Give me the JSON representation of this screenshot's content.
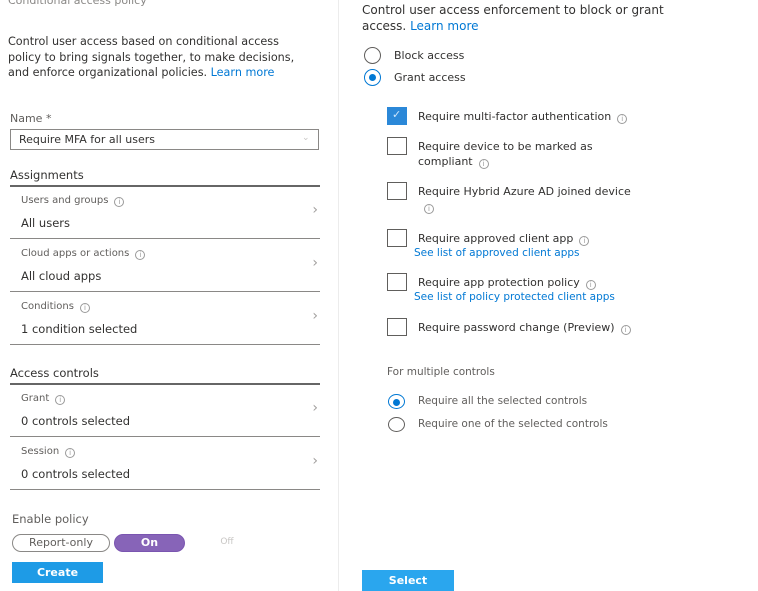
{
  "left": {
    "blade_title": "Conditional access policy",
    "description": "Control user access based on conditional access policy to bring signals together, to make decisions, and enforce organizational policies.",
    "learn_more": "Learn more",
    "name_label": "Name *",
    "name_value": "Require MFA for all users",
    "assignments_heading": "Assignments",
    "assignments": [
      {
        "label": "Users and groups",
        "value": "All users"
      },
      {
        "label": "Cloud apps or actions",
        "value": "All cloud apps"
      },
      {
        "label": "Conditions",
        "value": "1 condition selected"
      }
    ],
    "access_controls_heading": "Access controls",
    "access_controls": [
      {
        "label": "Grant",
        "value": "0 controls selected"
      },
      {
        "label": "Session",
        "value": "0 controls selected"
      }
    ],
    "enable_policy_label": "Enable policy",
    "toggle": {
      "report_only": "Report-only",
      "on": "On",
      "off": "Off",
      "selected": "On"
    },
    "create_label": "Create"
  },
  "right": {
    "description": "Control user access enforcement to block or grant access.",
    "learn_more": "Learn more",
    "access_options": [
      {
        "label": "Block access",
        "selected": false
      },
      {
        "label": "Grant access",
        "selected": true
      }
    ],
    "controls": [
      {
        "label": "Require multi-factor authentication",
        "checked": true
      },
      {
        "label": "Require device to be marked as compliant",
        "checked": false
      },
      {
        "label": "Require Hybrid Azure AD joined device",
        "checked": false
      },
      {
        "label": "Require approved client app",
        "checked": false,
        "link": "See list of approved client apps"
      },
      {
        "label": "Require app protection policy",
        "checked": false,
        "link": "See list of policy protected client apps"
      },
      {
        "label": "Require password change (Preview)",
        "checked": false
      }
    ],
    "multiple_controls_label": "For multiple controls",
    "multiple_options": [
      {
        "label": "Require all the selected controls",
        "selected": true
      },
      {
        "label": "Require one of the selected controls",
        "selected": false
      }
    ],
    "select_label": "Select"
  },
  "colors": {
    "accent": "#0078d4",
    "toggle_on": "#8764b8",
    "button": "#1e9be6"
  }
}
